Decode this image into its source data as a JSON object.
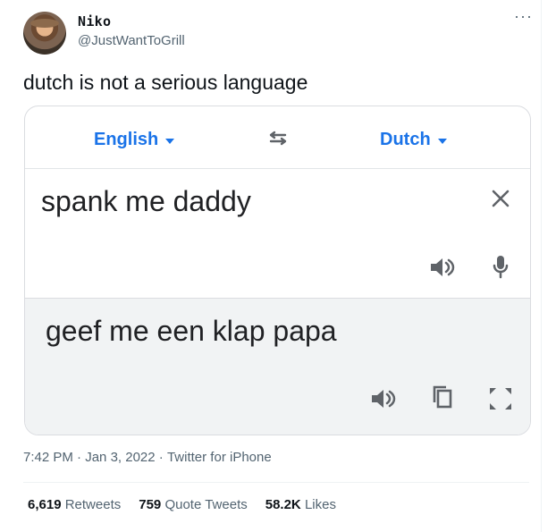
{
  "tweet": {
    "author_name": "Niko",
    "handle": "@JustWantToGrill",
    "text": "dutch is not a serious language"
  },
  "translate": {
    "source_language": "English",
    "target_language": "Dutch",
    "source_text": "spank me daddy",
    "translated_text": "geef me een klap papa"
  },
  "meta": {
    "time": "7:42 PM",
    "date": "Jan 3, 2022",
    "client": "Twitter for iPhone"
  },
  "stats": {
    "retweets_count": "6,619",
    "retweets_label": "Retweets",
    "quotes_count": "759",
    "quotes_label": "Quote Tweets",
    "likes_count": "58.2K",
    "likes_label": "Likes"
  },
  "icons": {
    "more": "more-horizontal-icon",
    "swap": "swap-arrows-icon",
    "clear": "close-icon",
    "speaker": "speaker-icon",
    "mic": "microphone-icon",
    "copy": "copy-icon",
    "fullscreen": "fullscreen-icon"
  },
  "colors": {
    "link_blue": "#1a73e8",
    "muted_text": "#536471",
    "icon_gray": "#5f6368",
    "result_bg": "#f1f3f4"
  }
}
